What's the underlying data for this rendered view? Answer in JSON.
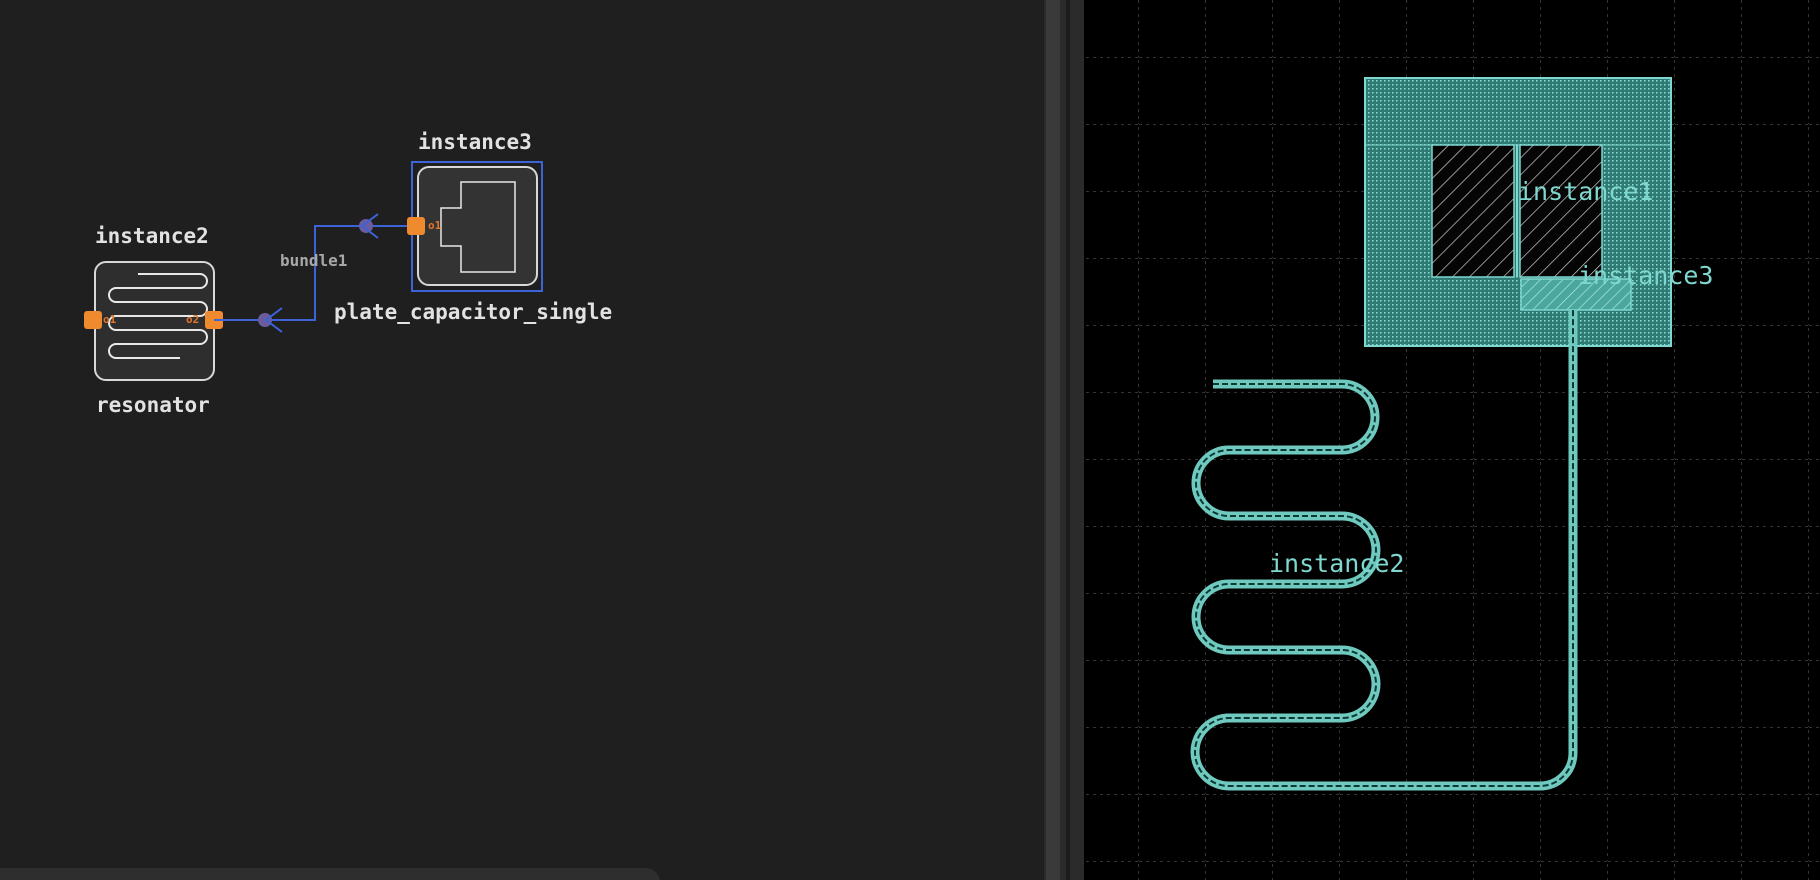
{
  "schematic": {
    "instances": [
      {
        "name": "instance2",
        "component": "resonator",
        "ports": [
          "o1",
          "o2"
        ]
      },
      {
        "name": "instance3",
        "component": "plate_capacitor_single",
        "ports": [
          "o1"
        ]
      }
    ],
    "bundles": [
      {
        "label": "bundle1"
      }
    ]
  },
  "layout": {
    "labels": {
      "instance1": "instance1",
      "instance2": "instance2",
      "instance3": "instance3"
    }
  },
  "colors": {
    "canvas": "#1f1f1f",
    "layout_bg": "#000000",
    "port": "#f08a2e",
    "wire": "#3c63d8",
    "layer": "#6fc9bf"
  }
}
